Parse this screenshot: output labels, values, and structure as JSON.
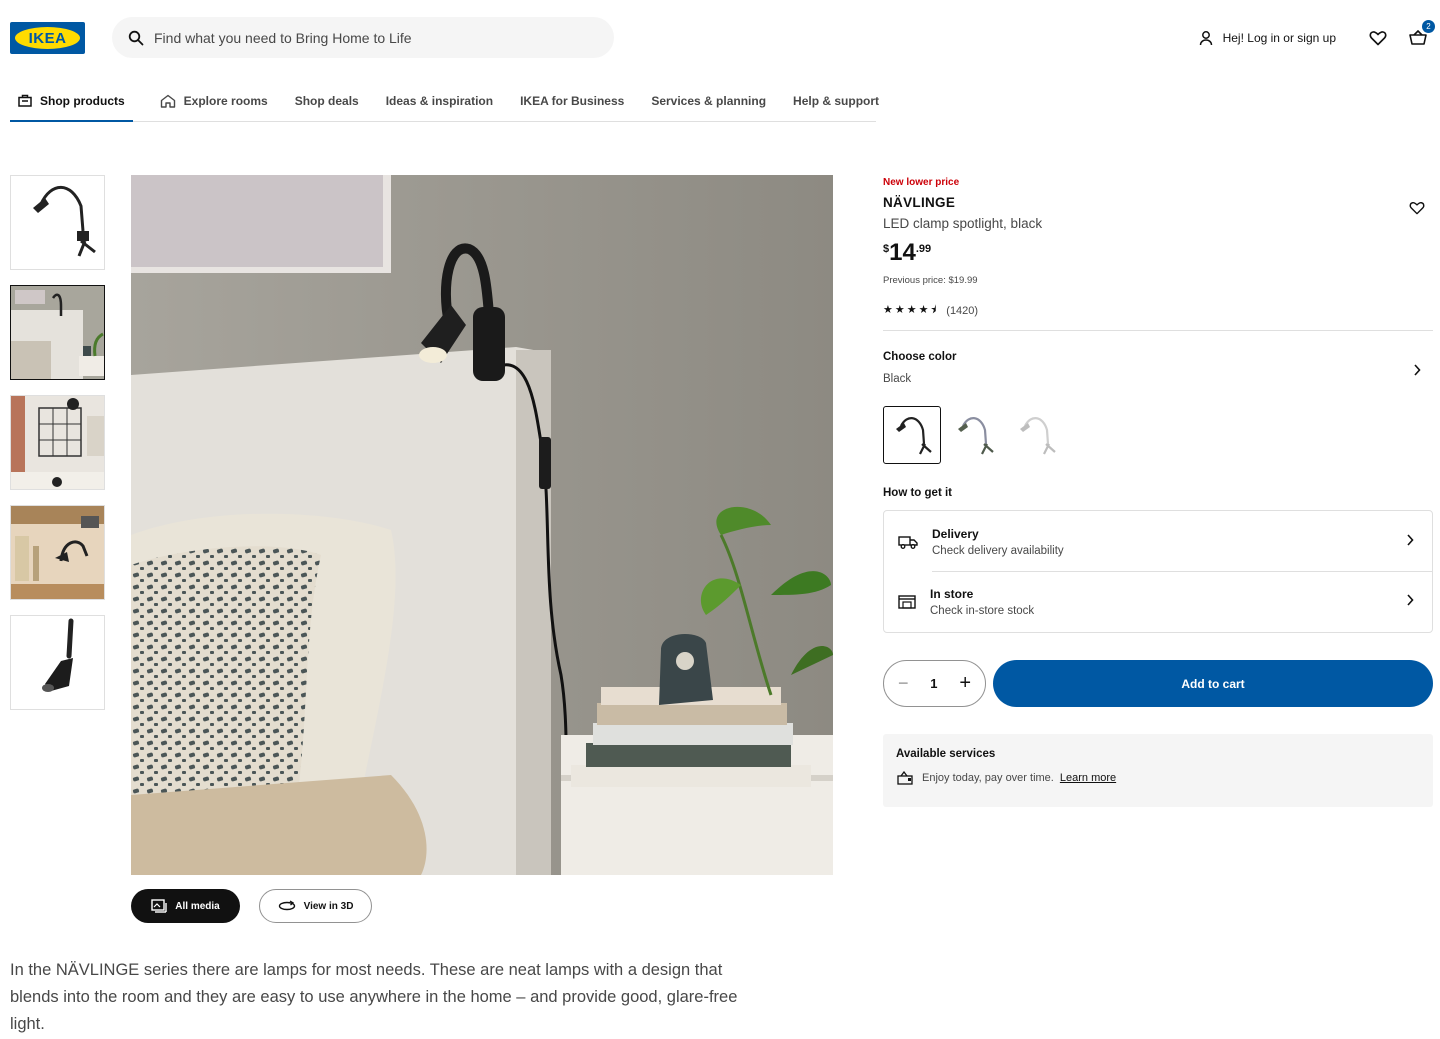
{
  "header": {
    "logo": "IKEA",
    "search_placeholder": "Find what you need to Bring Home to Life",
    "login_label": "Hej! Log in or sign up",
    "cart_count": "2"
  },
  "nav": {
    "items": [
      {
        "label": "Shop products"
      },
      {
        "label": "Explore rooms"
      },
      {
        "label": "Shop deals"
      },
      {
        "label": "Ideas & inspiration"
      },
      {
        "label": "IKEA for Business"
      },
      {
        "label": "Services & planning"
      },
      {
        "label": "Help & support"
      }
    ]
  },
  "media": {
    "all_media_label": "All media",
    "view_3d_label": "View in 3D"
  },
  "product": {
    "badge": "New lower price",
    "name": "NÄVLINGE",
    "description": "LED clamp spotlight, black",
    "price_currency": "$",
    "price_int": "14",
    "price_dec": ".99",
    "previous_price": "Previous price: $19.99",
    "stars": "★★★★⯨",
    "rating_value": 4.5,
    "review_count": "(1420)",
    "long_description": "In the NÄVLINGE series there are lamps for most needs. These are neat lamps with a design that blends into the room and they are easy to use anywhere in the home – and provide good, glare-free light."
  },
  "color": {
    "label": "Choose color",
    "value": "Black"
  },
  "fulfillment": {
    "label": "How to get it",
    "delivery_title": "Delivery",
    "delivery_sub": "Check delivery availability",
    "store_title": "In store",
    "store_sub": "Check in-store stock"
  },
  "purchase": {
    "quantity": "1",
    "add_to_cart": "Add to cart"
  },
  "services": {
    "title": "Available services",
    "text": "Enjoy today, pay over time.",
    "link": "Learn more"
  },
  "colors": {
    "brand_blue": "#0058a3",
    "brand_yellow": "#ffdb00",
    "sale_red": "#cc0008"
  }
}
